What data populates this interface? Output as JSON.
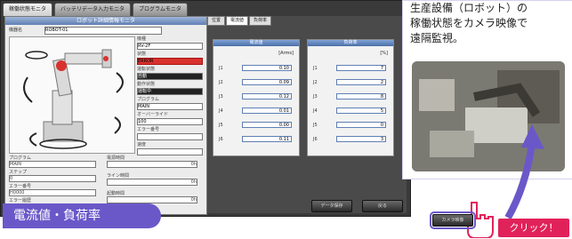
{
  "app": {
    "tabs": [
      "稼働状態モニタ",
      "バッテリデータ入力モニタ",
      "プログラムモニタ"
    ]
  },
  "left_panel": {
    "header": "ロボット詳細情報モニタ",
    "name_label": "機器名",
    "name_value": "ROBOT-01",
    "right_labels": [
      "機種",
      "状態",
      "運転状態",
      "動作状態",
      "プログラム",
      "オーバーライド",
      "エラー番号",
      "速度"
    ],
    "right_values": [
      "RV-2F",
      "ERROR",
      "自動",
      "運転中",
      "MAIN",
      "100",
      "",
      ""
    ],
    "lower_labels": [
      "プログラム",
      "ステップ",
      "エラー番号",
      "エラー履歴",
      "電源時間",
      "ライン時間",
      "起動時間"
    ],
    "lower_values": [
      "MAIN",
      "0",
      "H0000",
      "",
      "0h",
      "0h",
      "0h"
    ],
    "small_value": "100"
  },
  "right_panel": {
    "tabs": [
      "位置",
      "電流値",
      "負荷率"
    ],
    "panel1": {
      "title": "電流値",
      "unit": "[Arms]",
      "rows": [
        {
          "axis": "J1",
          "value": "0.10"
        },
        {
          "axis": "J2",
          "value": "0.09"
        },
        {
          "axis": "J3",
          "value": "0.12"
        },
        {
          "axis": "J4",
          "value": "0.01"
        },
        {
          "axis": "J5",
          "value": "0.00"
        },
        {
          "axis": "J6",
          "value": "0.11"
        }
      ]
    },
    "panel2": {
      "title": "負荷率",
      "unit": "[%]",
      "rows": [
        {
          "axis": "J1",
          "value": "7"
        },
        {
          "axis": "J2",
          "value": "2"
        },
        {
          "axis": "J3",
          "value": "8"
        },
        {
          "axis": "J4",
          "value": "5"
        },
        {
          "axis": "J5",
          "value": "0"
        },
        {
          "axis": "J6",
          "value": "3"
        }
      ]
    },
    "buttons": [
      "データ保存",
      "戻る",
      "カメラ映像"
    ]
  },
  "callout": {
    "text": "生産設備（ロボット）の\n稼働状態をカメラ映像で\n遠隔監視。"
  },
  "badge": {
    "label": "電流値・負荷率"
  },
  "click_label": "クリック！",
  "colors": {
    "accent": "#6a58c9",
    "click": "#e1225a",
    "error": "#d8322f"
  }
}
